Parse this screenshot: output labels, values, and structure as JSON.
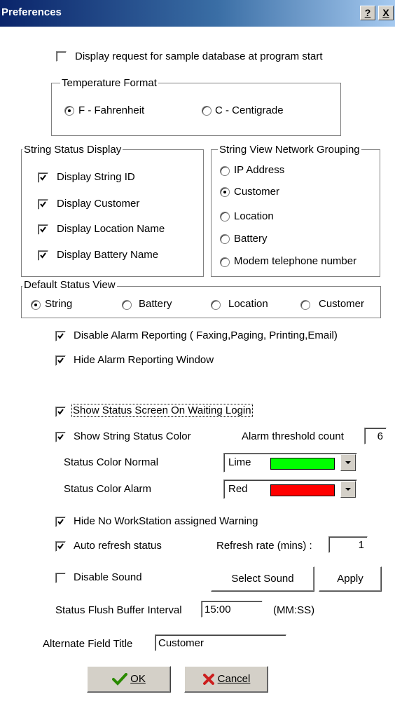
{
  "window": {
    "title": "Preferences",
    "help_label": "?",
    "close_label": "X"
  },
  "sample_db": {
    "label": "Display request for sample database at program start",
    "checked": false
  },
  "temperature_format": {
    "legend": "Temperature Format",
    "fahrenheit": "F - Fahrenheit",
    "centigrade": "C - Centigrade",
    "selected": "F - Fahrenheit"
  },
  "string_status_display": {
    "legend": "String Status Display",
    "items": [
      {
        "label": "Display String ID",
        "checked": true
      },
      {
        "label": "Display Customer",
        "checked": true
      },
      {
        "label": "Display Location Name",
        "checked": true
      },
      {
        "label": "Display Battery Name",
        "checked": true
      }
    ]
  },
  "network_grouping": {
    "legend": "String View Network Grouping",
    "options": [
      "IP Address",
      "Customer",
      "Location",
      "Battery",
      "Modem telephone number"
    ],
    "selected": "Customer"
  },
  "default_status_view": {
    "legend": "Default Status View",
    "options": [
      "String",
      "Battery",
      "Location",
      "Customer"
    ],
    "selected": "String"
  },
  "options": {
    "disable_alarm": {
      "label": "Disable Alarm Reporting ( Faxing,Paging, Printing,Email)",
      "checked": true
    },
    "hide_alarm_window": {
      "label": "Hide Alarm Reporting Window",
      "checked": true
    },
    "show_status_screen": {
      "label": "Show Status Screen On Waiting Login",
      "checked": true
    },
    "show_string_status_color": {
      "label": "Show String Status Color",
      "checked": true
    },
    "hide_no_workstation": {
      "label": "Hide No WorkStation assigned Warning",
      "checked": true
    },
    "auto_refresh": {
      "label": "Auto refresh status",
      "checked": true
    },
    "disable_sound": {
      "label": "Disable Sound",
      "checked": false
    }
  },
  "alarm_threshold": {
    "label": "Alarm threshold count",
    "value": "6"
  },
  "status_color_normal": {
    "label": "Status Color Normal",
    "value": "Lime",
    "color": "#00ff00"
  },
  "status_color_alarm": {
    "label": "Status Color Alarm",
    "value": "Red",
    "color": "#ff0000"
  },
  "refresh_rate": {
    "label": "Refresh rate (mins) :",
    "value": "1"
  },
  "buttons": {
    "select_sound": "Select Sound",
    "apply": "Apply",
    "ok": "OK",
    "cancel": "Cancel"
  },
  "flush_buffer": {
    "label": "Status Flush Buffer Interval",
    "value": "15:00",
    "unit": "(MM:SS)"
  },
  "alternate_field": {
    "label": "Alternate Field Title",
    "value": "Customer"
  }
}
